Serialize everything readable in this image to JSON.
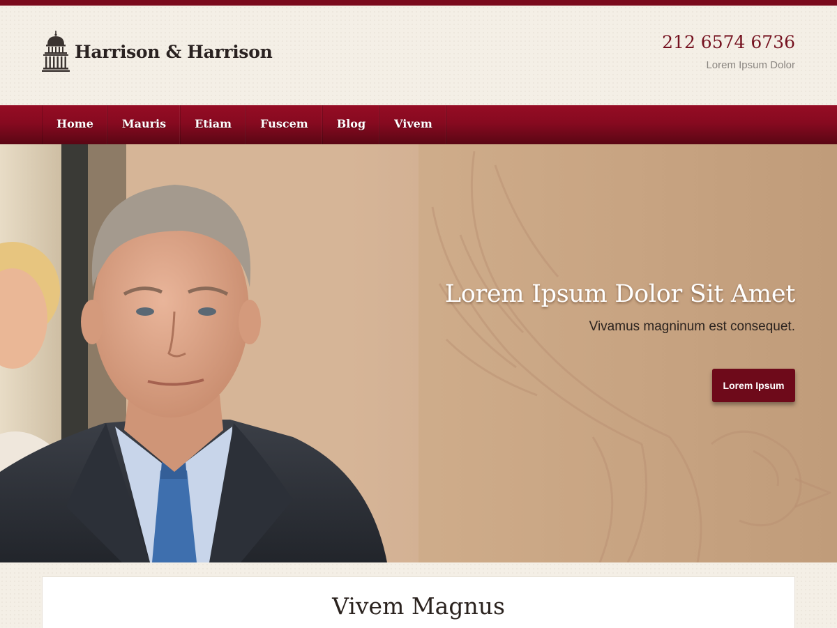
{
  "brand": {
    "name": "Harrison & Harrison",
    "icon": "capitol-dome-icon"
  },
  "contact": {
    "phone": "212 6574 6736",
    "subtitle": "Lorem Ipsum Dolor"
  },
  "nav": {
    "items": [
      {
        "label": "Home"
      },
      {
        "label": "Mauris"
      },
      {
        "label": "Etiam"
      },
      {
        "label": "Fuscem"
      },
      {
        "label": "Blog"
      },
      {
        "label": "Vivem"
      }
    ]
  },
  "hero": {
    "title": "Lorem Ipsum Dolor Sit Amet",
    "subtitle": "Vivamus magninum est consequet.",
    "button_label": "Lorem Ipsum"
  },
  "section": {
    "title": "Vivem Magnus"
  },
  "colors": {
    "accent": "#7a0a1c",
    "nav": "#870a20",
    "hero_bg": "#d0ae8c"
  }
}
